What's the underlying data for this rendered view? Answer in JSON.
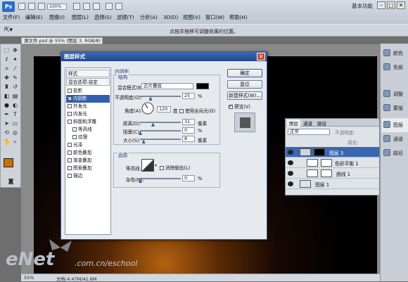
{
  "app": {
    "logo": "Ps",
    "zoom": "100%",
    "workspace": "基本功能",
    "win_controls": [
      "–",
      "□",
      "✕"
    ]
  },
  "menubar": {
    "items": [
      "文件(F)",
      "编辑(E)",
      "图像(I)",
      "图层(L)",
      "选择(S)",
      "滤镜(T)",
      "分析(A)",
      "3D(D)",
      "视图(V)",
      "窗口(W)",
      "帮助(H)"
    ]
  },
  "options_bar": {
    "hint": "点按并拖移可调整效果的位置。"
  },
  "document": {
    "tab": "源文件.psd @ 55% (图层 3, RGB/8) *",
    "status_zoom": "55%",
    "status_doc": "文档:4.47M/41.6M"
  },
  "dock": {
    "items": [
      "颜色",
      "色板",
      "调整",
      "蒙版",
      "图层",
      "通道",
      "路径"
    ]
  },
  "layers_panel": {
    "tabs": [
      "图层",
      "通道",
      "路径"
    ],
    "blend_mode": "正常",
    "opacity_label": "不透明度:",
    "fill_label": "填充:",
    "rows": [
      {
        "name": "图层 3",
        "selected": true
      },
      {
        "name": "色彩平衡 1",
        "selected": false
      },
      {
        "name": "曲线 1",
        "selected": false
      },
      {
        "name": "图层 1",
        "selected": false
      }
    ]
  },
  "dialog": {
    "title": "图层样式",
    "close": "✕",
    "styles_header": "样式",
    "blend_options": "混合选项:自定",
    "style_items": [
      {
        "label": "投影",
        "checked": false,
        "selected": false
      },
      {
        "label": "内阴影",
        "checked": true,
        "selected": true
      },
      {
        "label": "外发光",
        "checked": false,
        "selected": false
      },
      {
        "label": "内发光",
        "checked": false,
        "selected": false
      },
      {
        "label": "斜面和浮雕",
        "checked": false,
        "selected": false
      },
      {
        "label": "等高线",
        "checked": false,
        "selected": false,
        "indent": true
      },
      {
        "label": "纹理",
        "checked": false,
        "selected": false,
        "indent": true
      },
      {
        "label": "光泽",
        "checked": false,
        "selected": false
      },
      {
        "label": "颜色叠加",
        "checked": false,
        "selected": false
      },
      {
        "label": "渐变叠加",
        "checked": false,
        "selected": false
      },
      {
        "label": "图案叠加",
        "checked": false,
        "selected": false
      },
      {
        "label": "描边",
        "checked": false,
        "selected": false
      }
    ],
    "section_title": "内阴影",
    "structure_title": "结构",
    "blend_mode_label": "混合模式(B):",
    "blend_mode_value": "正片叠底",
    "shadow_color": "#000000",
    "opacity_label": "不透明度(O):",
    "opacity_value": "25",
    "angle_label": "角度(A):",
    "angle_value": "120",
    "angle_unit": "度",
    "global_light_label": "使用全局光(G)",
    "distance_label": "距离(D):",
    "distance_value": "31",
    "choke_label": "阻塞(C):",
    "choke_value": "0",
    "size_label": "大小(S):",
    "size_value": "8",
    "unit_px": "像素",
    "unit_pct": "%",
    "quality_title": "品质",
    "contour_label": "等高线:",
    "anti_alias_label": "消除锯齿(L)",
    "noise_label": "杂色(N):",
    "noise_value": "0",
    "buttons": {
      "ok": "确定",
      "reset": "复位",
      "new_style": "新建样式(W)...",
      "preview": "预览(V)"
    }
  },
  "watermark": {
    "logo": "eNet",
    "url": ".com.cn/eschool"
  }
}
